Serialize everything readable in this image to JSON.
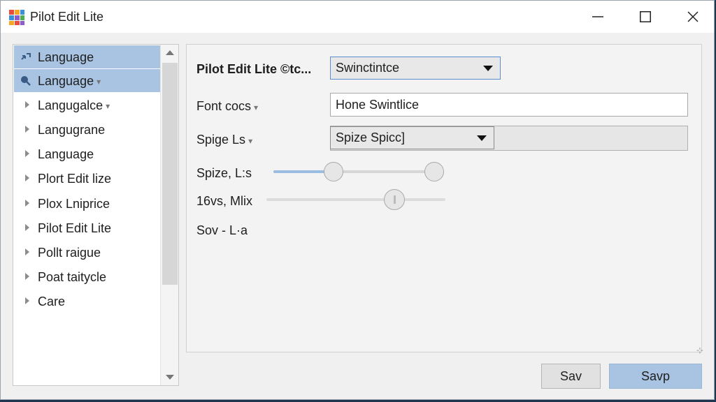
{
  "window": {
    "title": "Pilot Edit Lite",
    "minimize_icon": "minimize-icon",
    "maximize_icon": "maximize-icon",
    "close_icon": "close-icon"
  },
  "sidebar": {
    "items": [
      {
        "label": "Language",
        "icon": "translate-icon",
        "selected": true,
        "dropdown": ""
      },
      {
        "label": "Language",
        "icon": "search-icon",
        "selected": true,
        "dropdown": "▾"
      },
      {
        "label": "Langugalce",
        "icon": "chevron-right-icon",
        "selected": false,
        "dropdown": "▾"
      },
      {
        "label": "Langugrane",
        "icon": "chevron-right-icon",
        "selected": false,
        "dropdown": ""
      },
      {
        "label": "Language",
        "icon": "chevron-right-icon",
        "selected": false,
        "dropdown": ""
      },
      {
        "label": "Plort Edit lize",
        "icon": "chevron-right-icon",
        "selected": false,
        "dropdown": ""
      },
      {
        "label": "Plox Lniprice",
        "icon": "chevron-right-icon",
        "selected": false,
        "dropdown": ""
      },
      {
        "label": "Pilot Edit Lite",
        "icon": "chevron-right-icon",
        "selected": false,
        "dropdown": ""
      },
      {
        "label": "Pollt raigue",
        "icon": "chevron-right-icon",
        "selected": false,
        "dropdown": ""
      },
      {
        "label": "Poat taitycle",
        "icon": "chevron-right-icon",
        "selected": false,
        "dropdown": ""
      },
      {
        "label": "Care",
        "icon": "chevron-right-icon",
        "selected": false,
        "dropdown": ""
      }
    ]
  },
  "settings": {
    "row1": {
      "label": "Pilot Edit Lite ©tc...",
      "value": "Swinctintce"
    },
    "row2": {
      "label": "Font cocs",
      "value": "Hone Swintlice"
    },
    "row3": {
      "label": "Spige Ls",
      "value": "Spize Spicc]"
    },
    "row4": {
      "label": "Spize, L:s",
      "fraction": 0.35
    },
    "row5": {
      "label": "16vs, Mlix",
      "fraction": 0.71
    },
    "row6": {
      "label": "Sov - L·a"
    }
  },
  "buttons": {
    "secondary": "Sav",
    "primary": "Savp"
  },
  "colors": {
    "selection": "#a9c4e3",
    "accent": "#5a8ed0"
  }
}
